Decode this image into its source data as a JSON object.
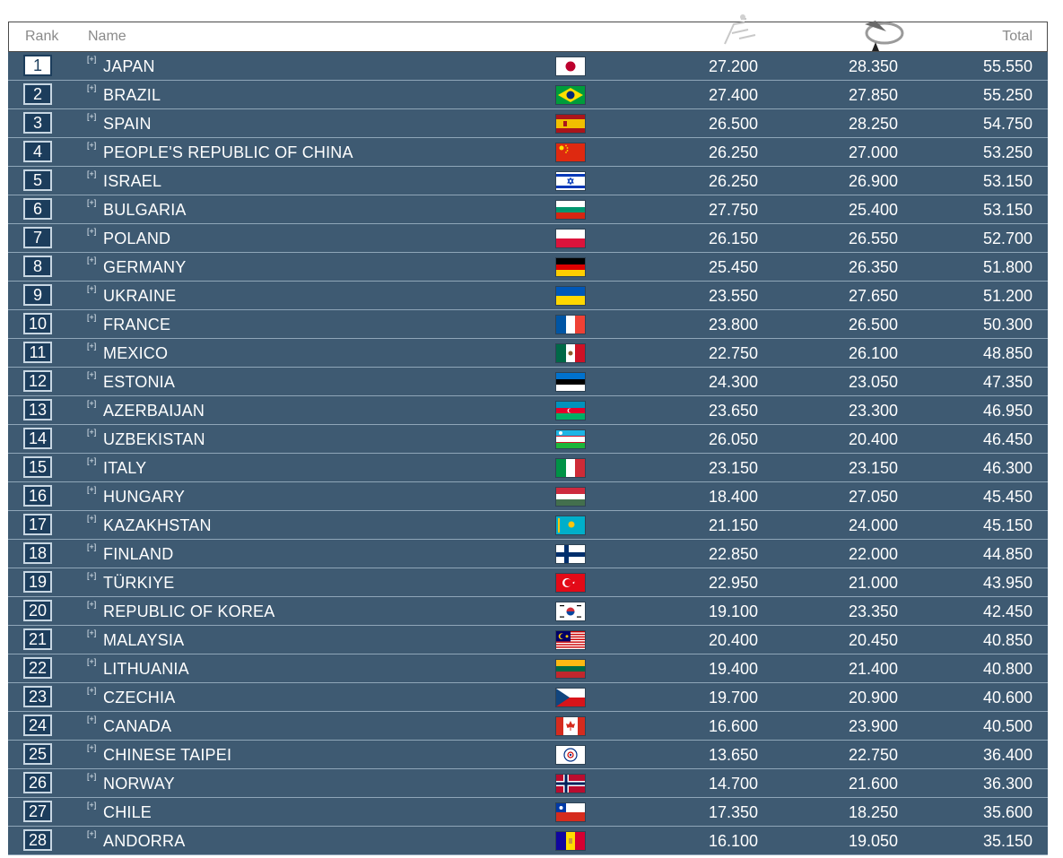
{
  "header": {
    "rank_label": "Rank",
    "name_label": "Name",
    "score1_icon": "apparatus-1-icon",
    "score2_icon": "apparatus-2-icon",
    "total_label": "Total"
  },
  "expander_label": "[+]",
  "rows": [
    {
      "rank": "1",
      "name": "JAPAN",
      "flag": "japan-flag-icon",
      "s1": "27.200",
      "s2": "28.350",
      "total": "55.550"
    },
    {
      "rank": "2",
      "name": "BRAZIL",
      "flag": "brazil-flag-icon",
      "s1": "27.400",
      "s2": "27.850",
      "total": "55.250"
    },
    {
      "rank": "3",
      "name": "SPAIN",
      "flag": "spain-flag-icon",
      "s1": "26.500",
      "s2": "28.250",
      "total": "54.750"
    },
    {
      "rank": "4",
      "name": "PEOPLE'S REPUBLIC OF CHINA",
      "flag": "china-flag-icon",
      "s1": "26.250",
      "s2": "27.000",
      "total": "53.250"
    },
    {
      "rank": "5",
      "name": "ISRAEL",
      "flag": "israel-flag-icon",
      "s1": "26.250",
      "s2": "26.900",
      "total": "53.150"
    },
    {
      "rank": "6",
      "name": "BULGARIA",
      "flag": "bulgaria-flag-icon",
      "s1": "27.750",
      "s2": "25.400",
      "total": "53.150"
    },
    {
      "rank": "7",
      "name": "POLAND",
      "flag": "poland-flag-icon",
      "s1": "26.150",
      "s2": "26.550",
      "total": "52.700"
    },
    {
      "rank": "8",
      "name": "GERMANY",
      "flag": "germany-flag-icon",
      "s1": "25.450",
      "s2": "26.350",
      "total": "51.800"
    },
    {
      "rank": "9",
      "name": "UKRAINE",
      "flag": "ukraine-flag-icon",
      "s1": "23.550",
      "s2": "27.650",
      "total": "51.200"
    },
    {
      "rank": "10",
      "name": "FRANCE",
      "flag": "france-flag-icon",
      "s1": "23.800",
      "s2": "26.500",
      "total": "50.300"
    },
    {
      "rank": "11",
      "name": "MEXICO",
      "flag": "mexico-flag-icon",
      "s1": "22.750",
      "s2": "26.100",
      "total": "48.850"
    },
    {
      "rank": "12",
      "name": "ESTONIA",
      "flag": "estonia-flag-icon",
      "s1": "24.300",
      "s2": "23.050",
      "total": "47.350"
    },
    {
      "rank": "13",
      "name": "AZERBAIJAN",
      "flag": "azerbaijan-flag-icon",
      "s1": "23.650",
      "s2": "23.300",
      "total": "46.950"
    },
    {
      "rank": "14",
      "name": "UZBEKISTAN",
      "flag": "uzbekistan-flag-icon",
      "s1": "26.050",
      "s2": "20.400",
      "total": "46.450"
    },
    {
      "rank": "15",
      "name": "ITALY",
      "flag": "italy-flag-icon",
      "s1": "23.150",
      "s2": "23.150",
      "total": "46.300"
    },
    {
      "rank": "16",
      "name": "HUNGARY",
      "flag": "hungary-flag-icon",
      "s1": "18.400",
      "s2": "27.050",
      "total": "45.450"
    },
    {
      "rank": "17",
      "name": "KAZAKHSTAN",
      "flag": "kazakhstan-flag-icon",
      "s1": "21.150",
      "s2": "24.000",
      "total": "45.150"
    },
    {
      "rank": "18",
      "name": "FINLAND",
      "flag": "finland-flag-icon",
      "s1": "22.850",
      "s2": "22.000",
      "total": "44.850"
    },
    {
      "rank": "19",
      "name": "TÜRKIYE",
      "flag": "turkiye-flag-icon",
      "s1": "22.950",
      "s2": "21.000",
      "total": "43.950"
    },
    {
      "rank": "20",
      "name": "REPUBLIC OF KOREA",
      "flag": "korea-flag-icon",
      "s1": "19.100",
      "s2": "23.350",
      "total": "42.450"
    },
    {
      "rank": "21",
      "name": "MALAYSIA",
      "flag": "malaysia-flag-icon",
      "s1": "20.400",
      "s2": "20.450",
      "total": "40.850"
    },
    {
      "rank": "22",
      "name": "LITHUANIA",
      "flag": "lithuania-flag-icon",
      "s1": "19.400",
      "s2": "21.400",
      "total": "40.800"
    },
    {
      "rank": "23",
      "name": "CZECHIA",
      "flag": "czechia-flag-icon",
      "s1": "19.700",
      "s2": "20.900",
      "total": "40.600"
    },
    {
      "rank": "24",
      "name": "CANADA",
      "flag": "canada-flag-icon",
      "s1": "16.600",
      "s2": "23.900",
      "total": "40.500"
    },
    {
      "rank": "25",
      "name": "CHINESE TAIPEI",
      "flag": "chinese-taipei-flag-icon",
      "s1": "13.650",
      "s2": "22.750",
      "total": "36.400"
    },
    {
      "rank": "26",
      "name": "NORWAY",
      "flag": "norway-flag-icon",
      "s1": "14.700",
      "s2": "21.600",
      "total": "36.300"
    },
    {
      "rank": "27",
      "name": "CHILE",
      "flag": "chile-flag-icon",
      "s1": "17.350",
      "s2": "18.250",
      "total": "35.600"
    },
    {
      "rank": "28",
      "name": "ANDORRA",
      "flag": "andorra-flag-icon",
      "s1": "16.100",
      "s2": "19.050",
      "total": "35.150"
    }
  ]
}
